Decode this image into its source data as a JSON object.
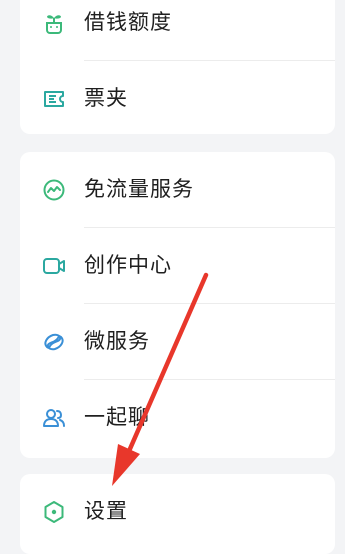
{
  "menu_groups": [
    {
      "items": [
        {
          "label": "借钱额度",
          "icon": "sprout-icon"
        },
        {
          "label": "票夹",
          "icon": "ticket-icon"
        }
      ]
    },
    {
      "items": [
        {
          "label": "免流量服务",
          "icon": "data-free-icon"
        },
        {
          "label": "创作中心",
          "icon": "video-camera-icon"
        },
        {
          "label": "微服务",
          "icon": "micro-service-icon"
        },
        {
          "label": "一起聊",
          "icon": "people-icon"
        }
      ]
    },
    {
      "items": [
        {
          "label": "设置",
          "icon": "settings-hexagon-icon"
        }
      ]
    }
  ],
  "colors": {
    "icon_green": "#3cb97a",
    "icon_teal": "#2ba8a0",
    "icon_blue": "#3a8fd6",
    "arrow_red": "#e8372b"
  }
}
